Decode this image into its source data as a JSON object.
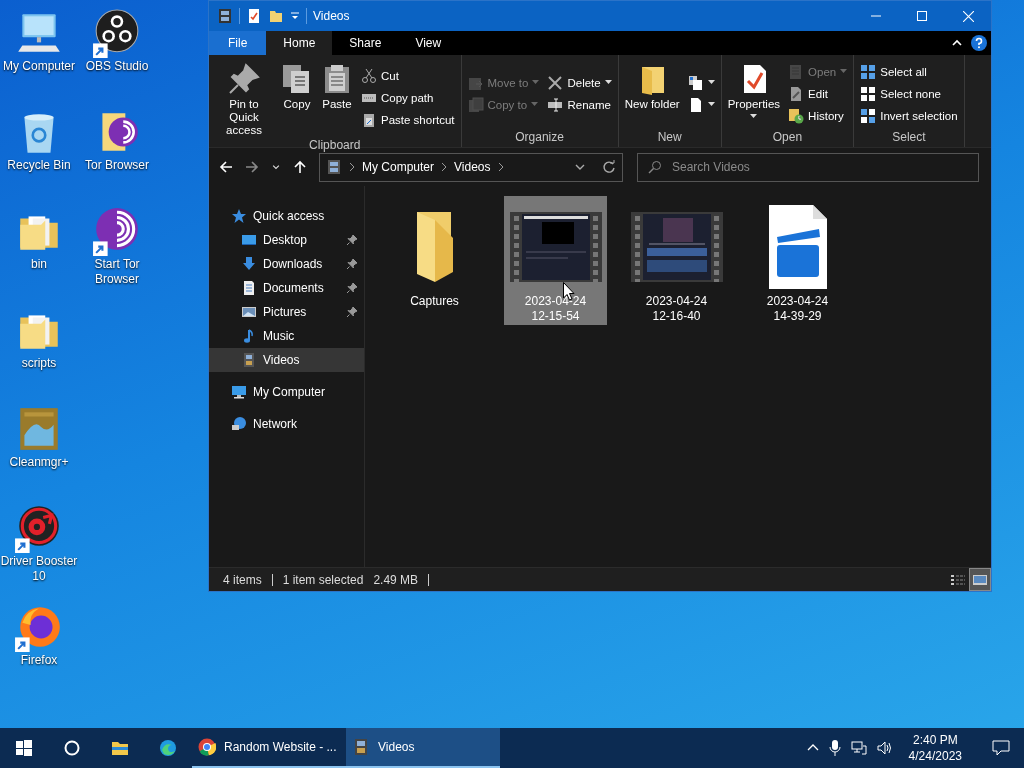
{
  "desktop": {
    "icons": [
      {
        "label": "My Computer",
        "kind": "computer",
        "shortcut": false
      },
      {
        "label": "Recycle Bin",
        "kind": "recycle",
        "shortcut": false
      },
      {
        "label": "bin",
        "kind": "folder",
        "shortcut": false
      },
      {
        "label": "scripts",
        "kind": "folder",
        "shortcut": false
      },
      {
        "label": "Cleanmgr+",
        "kind": "cleanmgr",
        "shortcut": false
      },
      {
        "label": "Driver Booster 10",
        "kind": "booster",
        "shortcut": true
      },
      {
        "label": "Firefox",
        "kind": "firefox",
        "shortcut": true
      },
      {
        "label": "OBS Studio",
        "kind": "obs",
        "shortcut": true
      },
      {
        "label": "Tor Browser",
        "kind": "tor-folder",
        "shortcut": false
      },
      {
        "label": "Start Tor Browser",
        "kind": "tor",
        "shortcut": true
      }
    ]
  },
  "window": {
    "title": "Videos",
    "tabs": [
      {
        "label": "File",
        "kind": "file",
        "selected": false
      },
      {
        "label": "Home",
        "kind": "tab",
        "selected": true
      },
      {
        "label": "Share",
        "kind": "tab",
        "selected": false
      },
      {
        "label": "View",
        "kind": "tab",
        "selected": false
      }
    ],
    "ribbon": [
      {
        "label": "Clipboard",
        "columns": [
          {
            "kind": "large",
            "commands": [
              {
                "label": "Pin to Quick access",
                "kind": "pin",
                "disabled": false,
                "dropdown": false
              }
            ]
          },
          {
            "kind": "large",
            "commands": [
              {
                "label": "Copy",
                "kind": "copy",
                "disabled": false,
                "dropdown": false
              }
            ]
          },
          {
            "kind": "large",
            "commands": [
              {
                "label": "Paste",
                "kind": "paste",
                "disabled": false,
                "dropdown": false
              }
            ]
          },
          {
            "kind": "stack",
            "commands": [
              {
                "label": "Cut",
                "kind": "cut",
                "disabled": false,
                "dropdown": false
              },
              {
                "label": "Copy path",
                "kind": "copy-path",
                "disabled": false,
                "dropdown": false
              },
              {
                "label": "Paste shortcut",
                "kind": "paste-shortcut",
                "disabled": false,
                "dropdown": false
              }
            ]
          }
        ]
      },
      {
        "label": "Organize",
        "columns": [
          {
            "kind": "stack",
            "commands": [
              {
                "label": "Move to",
                "kind": "move-to",
                "disabled": true,
                "dropdown": true
              },
              {
                "label": "Copy to",
                "kind": "copy-to",
                "disabled": true,
                "dropdown": true
              }
            ]
          },
          {
            "kind": "stack",
            "commands": [
              {
                "label": "Delete",
                "kind": "delete",
                "disabled": false,
                "dropdown": true
              },
              {
                "label": "Rename",
                "kind": "rename",
                "disabled": false,
                "dropdown": false
              }
            ]
          }
        ]
      },
      {
        "label": "New",
        "columns": [
          {
            "kind": "large",
            "commands": [
              {
                "label": "New folder",
                "kind": "new-folder",
                "disabled": false,
                "dropdown": false
              }
            ]
          },
          {
            "kind": "stack",
            "commands": [
              {
                "kind": "new-item",
                "disabled": false,
                "dropdown": true
              },
              {
                "kind": "easy-access",
                "disabled": false,
                "dropdown": true
              }
            ]
          }
        ]
      },
      {
        "label": "Open",
        "columns": [
          {
            "kind": "large",
            "commands": [
              {
                "label": "Properties",
                "kind": "properties",
                "disabled": false,
                "dropdown": true
              }
            ]
          },
          {
            "kind": "stack",
            "commands": [
              {
                "label": "Open",
                "kind": "open",
                "disabled": true,
                "dropdown": true
              },
              {
                "label": "Edit",
                "kind": "edit",
                "disabled": false,
                "dropdown": false
              },
              {
                "label": "History",
                "kind": "history",
                "disabled": false,
                "dropdown": false
              }
            ]
          }
        ]
      },
      {
        "label": "Select",
        "columns": [
          {
            "kind": "stack",
            "commands": [
              {
                "label": "Select all",
                "kind": "select-all",
                "disabled": false,
                "dropdown": false
              },
              {
                "label": "Select none",
                "kind": "select-none",
                "disabled": false,
                "dropdown": false
              },
              {
                "label": "Invert selection",
                "kind": "invert",
                "disabled": false,
                "dropdown": false
              }
            ]
          }
        ]
      }
    ],
    "address": {
      "path": [
        "My Computer",
        "Videos"
      ]
    },
    "search": {
      "placeholder": "Search Videos"
    },
    "nav_pane": [
      {
        "label": "Quick access",
        "kind": "quick-access",
        "selected": false,
        "children": [
          {
            "label": "Desktop",
            "kind": "desktop",
            "pinned": true,
            "selected": false
          },
          {
            "label": "Downloads",
            "kind": "downloads",
            "pinned": true,
            "selected": false
          },
          {
            "label": "Documents",
            "kind": "documents",
            "pinned": true,
            "selected": false
          },
          {
            "label": "Pictures",
            "kind": "pictures",
            "pinned": true,
            "selected": false
          },
          {
            "label": "Music",
            "kind": "music",
            "pinned": false,
            "selected": false
          },
          {
            "label": "Videos",
            "kind": "videos",
            "pinned": false,
            "selected": true
          }
        ]
      },
      {
        "label": "My Computer",
        "kind": "computer",
        "selected": false
      },
      {
        "label": "Network",
        "kind": "network",
        "selected": false
      }
    ],
    "items": [
      {
        "label": "Captures",
        "kind": "folder",
        "selected": false
      },
      {
        "label": "2023-04-24 12-15-54",
        "kind": "video-dark",
        "selected": true
      },
      {
        "label": "2023-04-24 12-16-40",
        "kind": "video-busy",
        "selected": false
      },
      {
        "label": "2023-04-24 14-39-29",
        "kind": "video-file",
        "selected": false
      }
    ],
    "status_bar": {
      "count": "4 items",
      "selection": "1 item selected",
      "size": "2.49 MB",
      "views": [
        {
          "kind": "details",
          "selected": false
        },
        {
          "kind": "large-icons",
          "selected": true
        }
      ]
    }
  },
  "taskbar": {
    "items": [
      {
        "kind": "start"
      },
      {
        "kind": "search"
      },
      {
        "kind": "explorer"
      },
      {
        "kind": "edge"
      },
      {
        "kind": "chrome",
        "label": "Random Website - ...",
        "running": true,
        "selected": false
      },
      {
        "kind": "videos",
        "label": "Videos",
        "running": true,
        "selected": true
      }
    ],
    "clock": {
      "time": "2:40 PM",
      "date": "4/24/2023"
    }
  }
}
